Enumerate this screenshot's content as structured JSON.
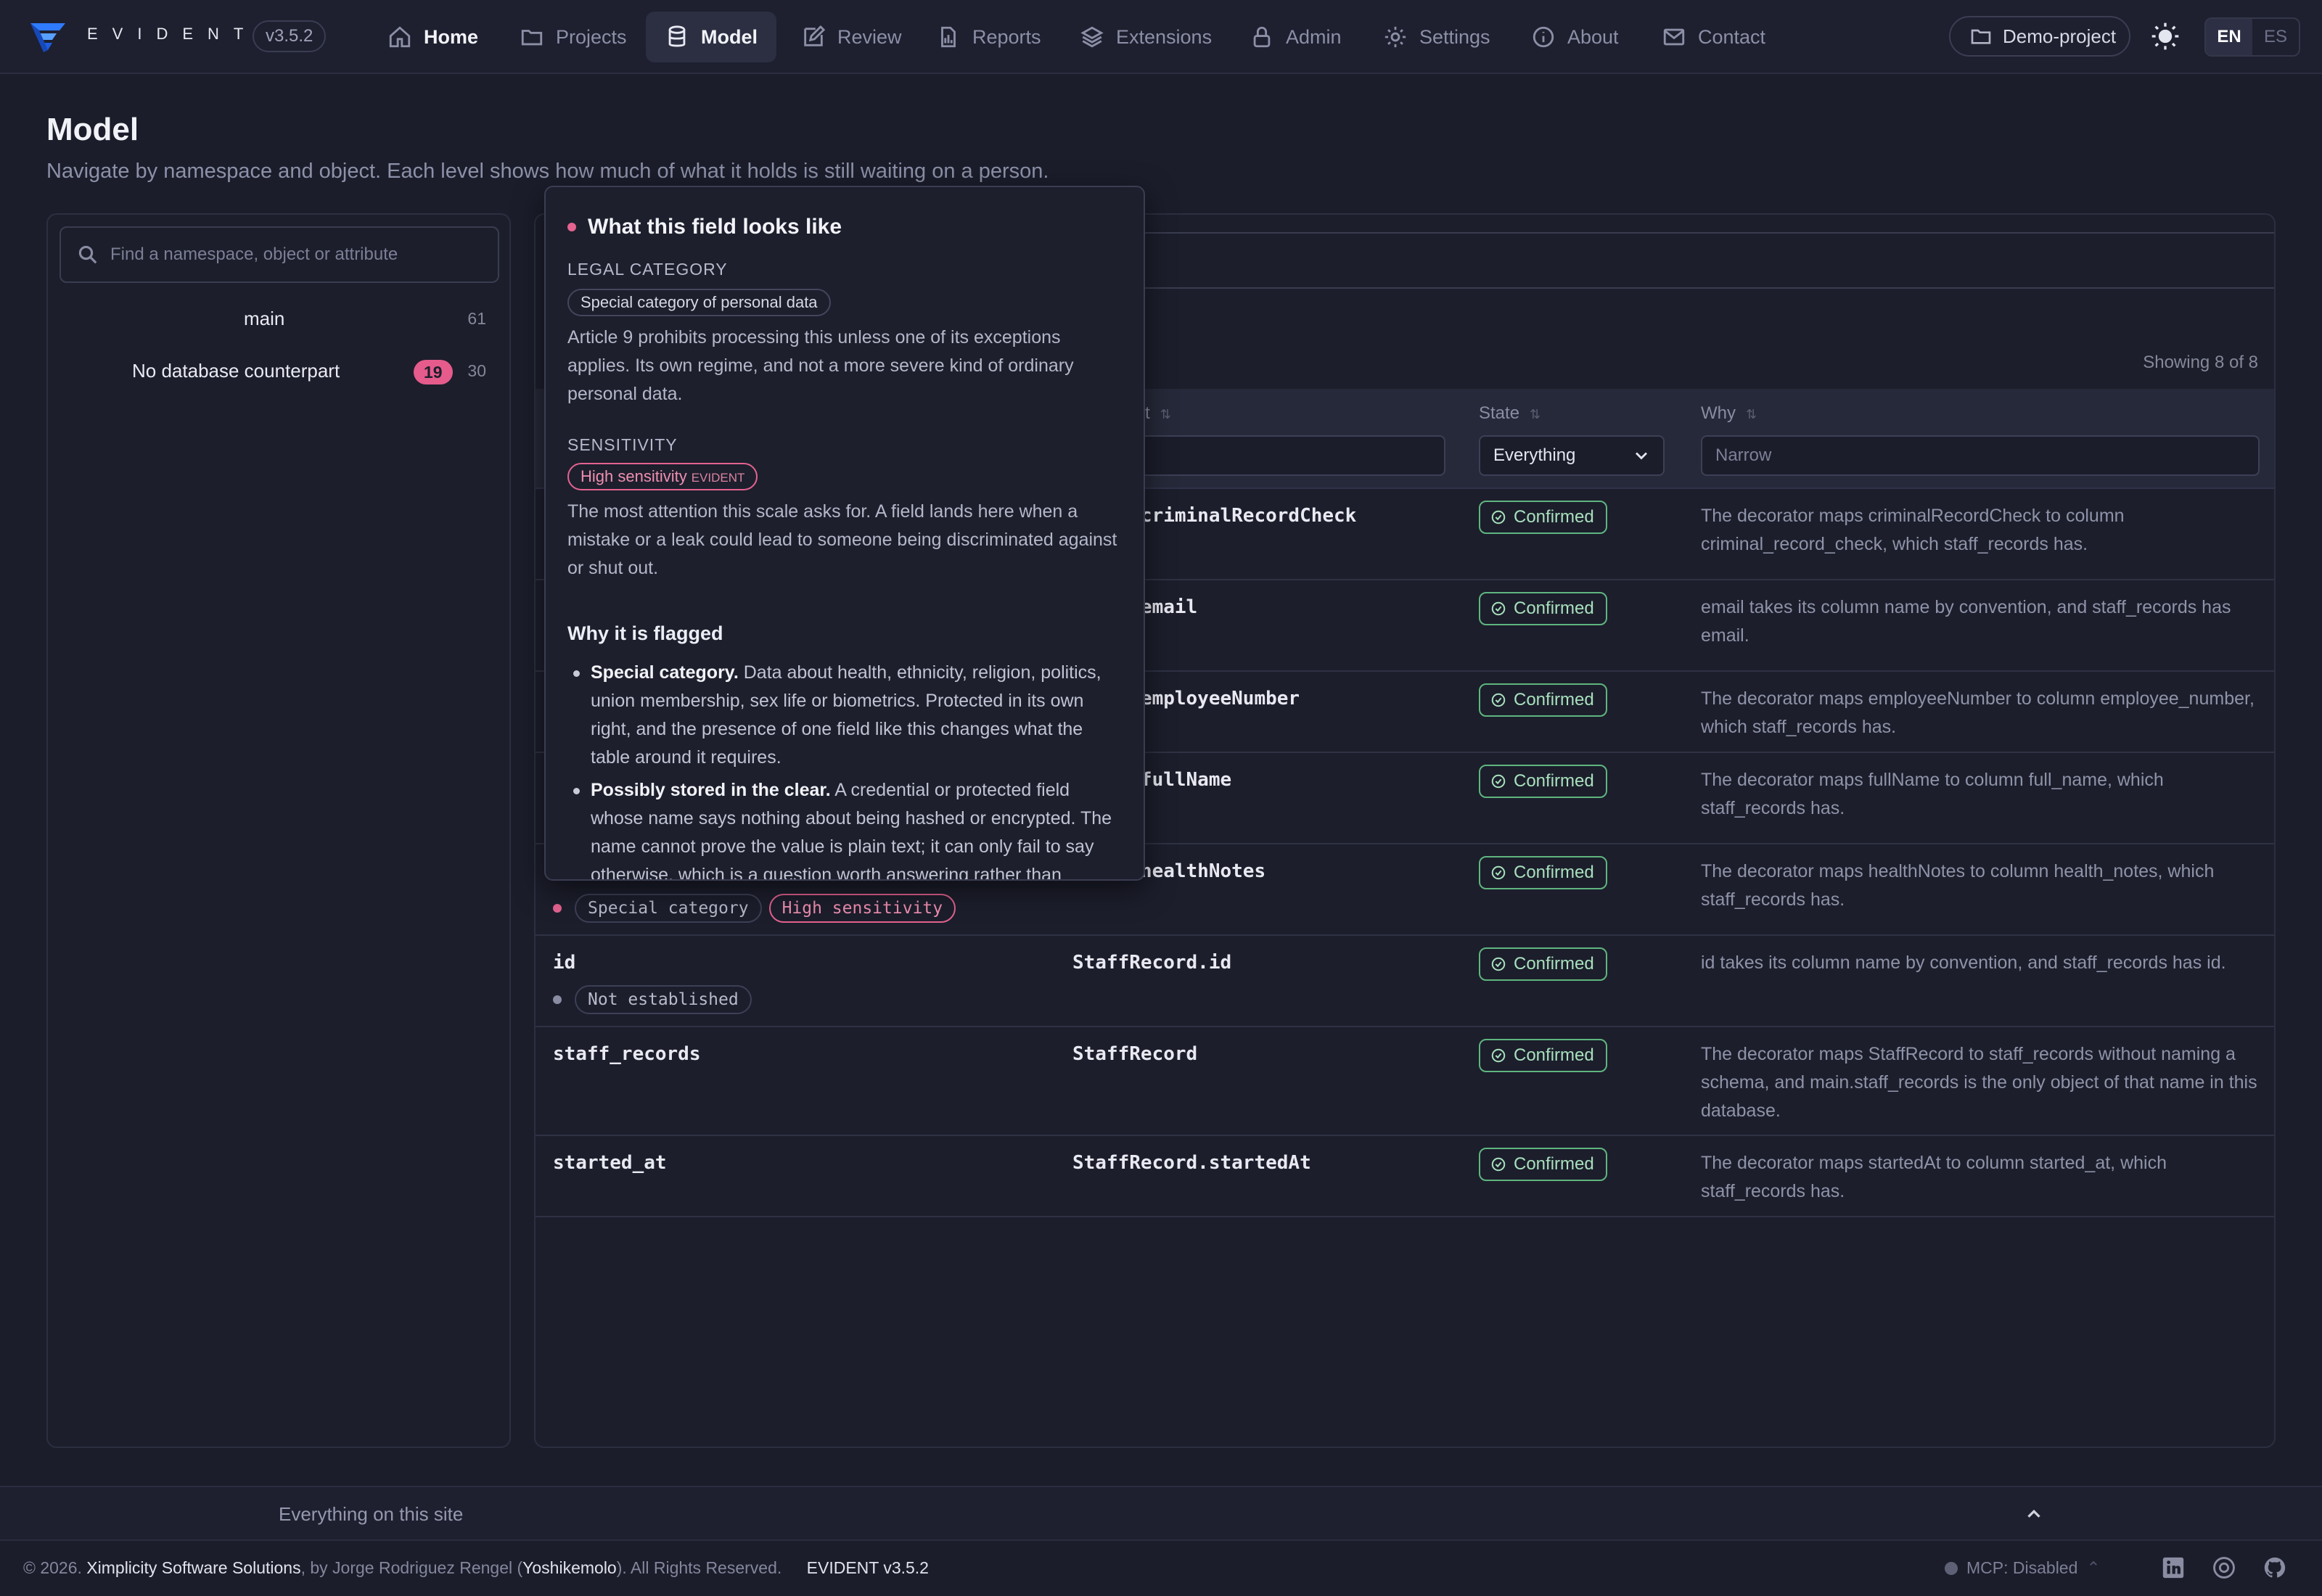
{
  "app": {
    "brand": "EVIDENT",
    "version": "v3.5.2"
  },
  "nav": [
    {
      "label": "Home",
      "icon": "home-icon",
      "active": false
    },
    {
      "label": "Projects",
      "icon": "folder-icon"
    },
    {
      "label": "Model",
      "icon": "database-icon",
      "active": true
    },
    {
      "label": "Review",
      "icon": "edit-icon"
    },
    {
      "label": "Reports",
      "icon": "report-icon"
    },
    {
      "label": "Extensions",
      "icon": "layers-icon"
    },
    {
      "label": "Admin",
      "icon": "lock-icon"
    },
    {
      "label": "Settings",
      "icon": "gear-icon"
    },
    {
      "label": "About",
      "icon": "info-icon"
    },
    {
      "label": "Contact",
      "icon": "mail-icon"
    }
  ],
  "project": {
    "label": "Demo-project"
  },
  "lang": {
    "en": "EN",
    "es": "ES"
  },
  "page": {
    "title": "Model",
    "subtitle": "Navigate by namespace and object. Each level shows how much of what it holds is still waiting on a person."
  },
  "tree": {
    "search_placeholder": "Find a namespace, object or attribute",
    "items": [
      {
        "label": "main",
        "count": "61"
      },
      {
        "label": "No database counterpart",
        "pending": "19",
        "count": "30"
      }
    ]
  },
  "table": {
    "showing": "Showing 8 of 8",
    "columns": {
      "element": "nent",
      "state": "State",
      "why": "Why"
    },
    "state_filter": "Everything",
    "why_placeholder": "Narrow",
    "rows": [
      {
        "name": "",
        "element": "ecord.criminalRecordCheck",
        "state": "Confirmed",
        "why": "The decorator maps criminalRecordCheck to column criminal_record_check, which staff_records has."
      },
      {
        "name": "",
        "element": "ecord.email",
        "state": "Confirmed",
        "why": "email takes its column name by convention, and staff_records has email."
      },
      {
        "name": "",
        "element": "ecord.employeeNumber",
        "state": "Confirmed",
        "why": "The decorator maps employeeNumber to column employee_number, which staff_records has."
      },
      {
        "name": "",
        "element": "ecord.fullName",
        "state": "Confirmed",
        "why": "The decorator maps fullName to column full_name, which staff_records has."
      },
      {
        "name": "",
        "element": "ecord.healthNotes",
        "state": "Confirmed",
        "why": "The decorator maps healthNotes to column health_notes, which staff_records has.",
        "tags": [
          "Special category",
          "High sensitivity"
        ]
      },
      {
        "name": "id",
        "element": "StaffRecord.id",
        "state": "Confirmed",
        "why": "id takes its column name by convention, and staff_records has id.",
        "tags": [
          "Not established"
        ]
      },
      {
        "name": "staff_records",
        "element": "StaffRecord",
        "state": "Confirmed",
        "why": "The decorator maps StaffRecord to staff_records without naming a schema, and main.staff_records is the only object of that name in this database."
      },
      {
        "name": "started_at",
        "element": "StaffRecord.startedAt",
        "state": "Confirmed",
        "why": "The decorator maps startedAt to column started_at, which staff_records has."
      }
    ]
  },
  "popover": {
    "title": "What this field looks like",
    "legal_caption": "LEGAL CATEGORY",
    "legal_chip": "Special category of personal data",
    "legal_text": "Article 9 prohibits processing this unless one of its exceptions applies. Its own regime, and not a more severe kind of ordinary personal data.",
    "sens_caption": "SENSITIVITY",
    "sens_chip": "High sensitivity",
    "sens_chip_src": "EVIDENT",
    "sens_text": "The most attention this scale asks for. A field lands here when a mistake or a leak could lead to someone being discriminated against or shut out.",
    "why_title": "Why it is flagged",
    "reasons": [
      {
        "bold": "Special category.",
        "text": "Data about health, ethnicity, religion, politics, union membership, sex life or biometrics. Protected in its own right, and the presence of one field like this changes what the table around it requires."
      },
      {
        "bold": "Possibly stored in the clear.",
        "text": "A credential or protected field whose name says nothing about being hashed or encrypted. The name cannot prove the value is plain text; it can only fail to say otherwise, which is a question worth answering rather than"
      }
    ]
  },
  "footer": {
    "site_toggle": "Everything on this site",
    "copy_prefix": "© 2026.",
    "company": "Ximplicity Software Solutions",
    "by": ", by Jorge Rodriguez Rengel (",
    "handle": "Yoshikemolo",
    "rights": "). All Rights Reserved.",
    "version": "EVIDENT v3.5.2",
    "mcp": "MCP: Disabled"
  },
  "colors": {
    "accent": "#2d6bff",
    "danger": "#e4638f",
    "ok": "#5fb57f"
  }
}
